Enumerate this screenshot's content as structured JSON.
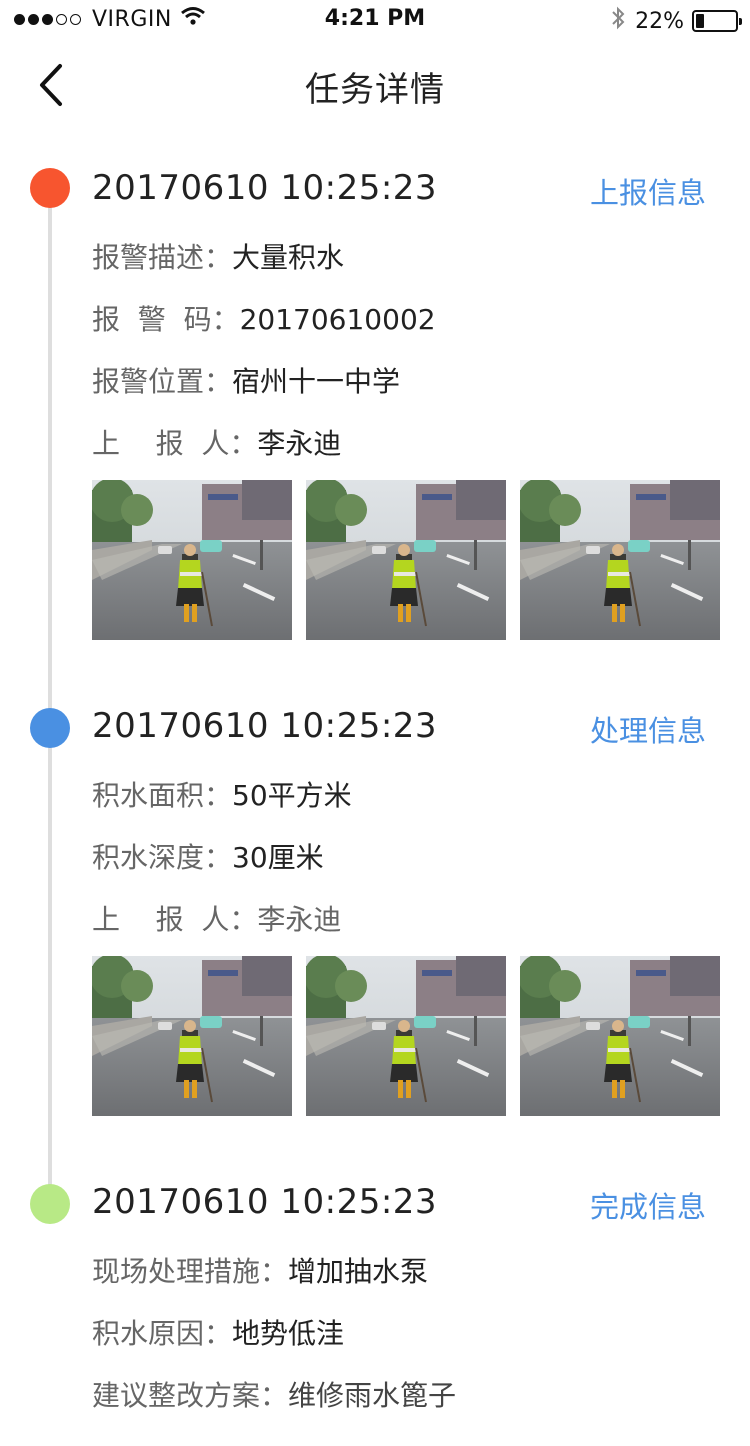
{
  "status_bar": {
    "carrier": "VIRGIN",
    "signal_bars_filled": 3,
    "signal_bars_total": 5,
    "time": "4:21 PM",
    "battery_percent": "22%",
    "battery_level": 0.22
  },
  "nav": {
    "title": "任务详情",
    "back_icon": "chevron-left-icon"
  },
  "colors": {
    "report_marker": "#f7552f",
    "process_marker": "#4a90e2",
    "complete_marker": "#b8e986",
    "link": "#4a90e2"
  },
  "sections": [
    {
      "timestamp": "20170610 10:25:23",
      "link": "上报信息",
      "fields": [
        {
          "label": "报警描述：",
          "value": "大量积水"
        },
        {
          "label": "报  警  码：",
          "value": "20170610002"
        },
        {
          "label": "报警位置：",
          "value": "宿州十一中学"
        },
        {
          "label": "上    报  人：",
          "value": "李永迪"
        }
      ]
    },
    {
      "timestamp": "20170610 10:25:23",
      "link": "处理信息",
      "fields": [
        {
          "label": "积水面积：",
          "value": "50平方米"
        },
        {
          "label": "积水深度：",
          "value": "30厘米"
        },
        {
          "label": "上    报  人：",
          "value": "李永迪"
        }
      ]
    },
    {
      "timestamp": "20170610 10:25:23",
      "link": "完成信息",
      "fields": [
        {
          "label": "现场处理措施：",
          "value": "增加抽水泵"
        },
        {
          "label": "积水原因：",
          "value": "地势低洼"
        },
        {
          "label": "建议整改方案：",
          "value": "维修雨水篦子"
        }
      ]
    }
  ]
}
